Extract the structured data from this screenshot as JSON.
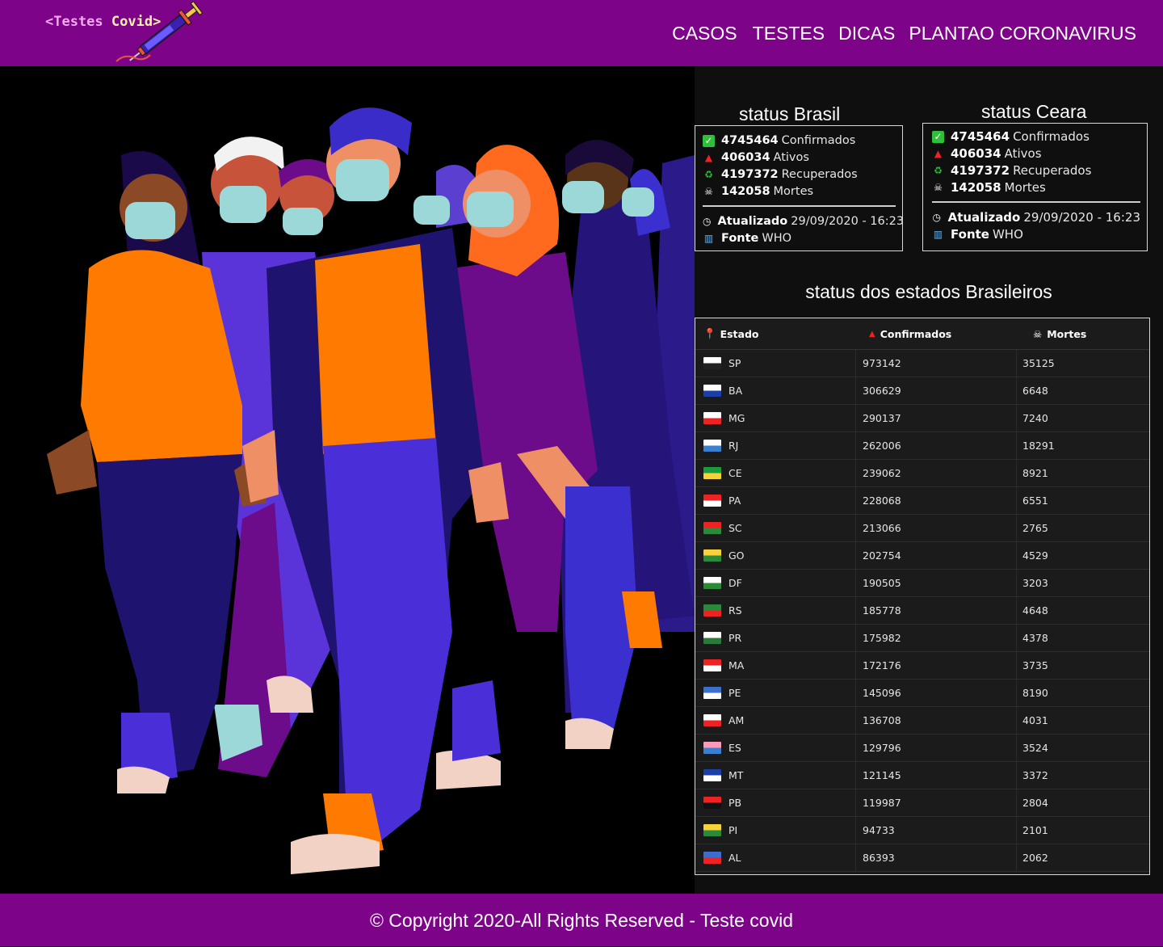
{
  "logo": {
    "part1": "<Testes ",
    "part2": "Covid>",
    "icon": "syringe-icon"
  },
  "nav": {
    "items": [
      "CASOS",
      "TESTES",
      "DICAS",
      "PLANTAO CORONAVIRUS"
    ]
  },
  "status_brasil": {
    "title": "status Brasil",
    "confirmed_value": "4745464",
    "confirmed_label": "Confirmados",
    "active_value": "406034",
    "active_label": "Ativos",
    "recovered_value": "4197372",
    "recovered_label": "Recuperados",
    "deaths_value": "142058",
    "deaths_label": "Mortes",
    "updated_label": "Atualizado",
    "updated_value": "29/09/2020 - 16:23",
    "source_label": "Fonte",
    "source_value": "WHO"
  },
  "status_ceara": {
    "title": "status  Ceara",
    "confirmed_value": "4745464",
    "confirmed_label": "Confirmados",
    "active_value": "406034",
    "active_label": "Ativos",
    "recovered_value": "4197372",
    "recovered_label": "Recuperados",
    "deaths_value": "142058",
    "deaths_label": "Mortes",
    "updated_label": "Atualizado",
    "updated_value": "29/09/2020 - 16:23",
    "source_label": "Fonte",
    "source_value": "WHO"
  },
  "states_table": {
    "title": "status dos estados  Brasileiros",
    "headers": {
      "state": "Estado",
      "confirmed": "Confirmados",
      "deaths": "Mortes"
    },
    "rows": [
      {
        "uf": "SP",
        "confirmed": "973142",
        "deaths": "35125"
      },
      {
        "uf": "BA",
        "confirmed": "306629",
        "deaths": "6648"
      },
      {
        "uf": "MG",
        "confirmed": "290137",
        "deaths": "7240"
      },
      {
        "uf": "RJ",
        "confirmed": "262006",
        "deaths": "18291"
      },
      {
        "uf": "CE",
        "confirmed": "239062",
        "deaths": "8921"
      },
      {
        "uf": "PA",
        "confirmed": "228068",
        "deaths": "6551"
      },
      {
        "uf": "SC",
        "confirmed": "213066",
        "deaths": "2765"
      },
      {
        "uf": "GO",
        "confirmed": "202754",
        "deaths": "4529"
      },
      {
        "uf": "DF",
        "confirmed": "190505",
        "deaths": "3203"
      },
      {
        "uf": "RS",
        "confirmed": "185778",
        "deaths": "4648"
      },
      {
        "uf": "PR",
        "confirmed": "175982",
        "deaths": "4378"
      },
      {
        "uf": "MA",
        "confirmed": "172176",
        "deaths": "3735"
      },
      {
        "uf": "PE",
        "confirmed": "145096",
        "deaths": "8190"
      },
      {
        "uf": "AM",
        "confirmed": "136708",
        "deaths": "4031"
      },
      {
        "uf": "ES",
        "confirmed": "129796",
        "deaths": "3524"
      },
      {
        "uf": "MT",
        "confirmed": "121145",
        "deaths": "3372"
      },
      {
        "uf": "PB",
        "confirmed": "119987",
        "deaths": "2804"
      },
      {
        "uf": "PI",
        "confirmed": "94733",
        "deaths": "2101"
      },
      {
        "uf": "AL",
        "confirmed": "86393",
        "deaths": "2062"
      }
    ]
  },
  "footer": {
    "text": "© Copyright 2020-All Rights Reserved - Teste covid"
  },
  "colors": {
    "header_bg": "#7d0489",
    "panel_bg": "#0f0f0f",
    "table_bg": "#1b1b1c"
  }
}
